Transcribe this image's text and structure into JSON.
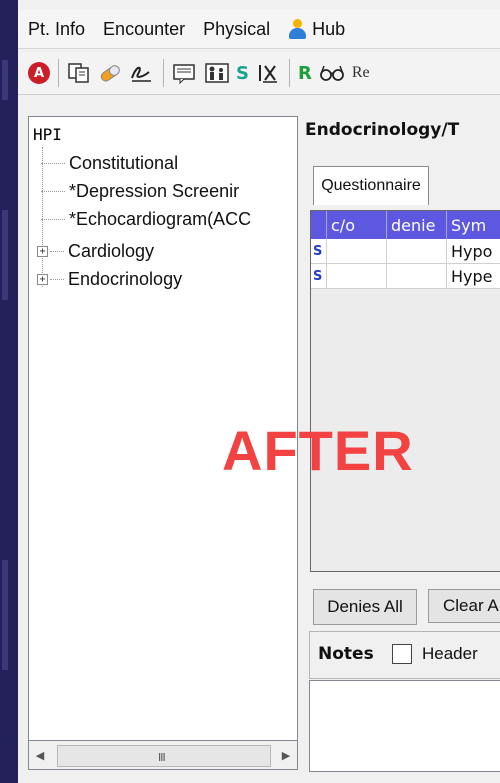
{
  "menu": {
    "items": [
      "Pt. Info",
      "Encounter",
      "Physical",
      "Hub"
    ]
  },
  "toolbar": {
    "stop_glyph": "A",
    "s_label": "S",
    "r_label": "R",
    "re_label": "Re"
  },
  "tree": {
    "root": "HPI",
    "items": [
      {
        "label": "Constitutional",
        "expandable": false
      },
      {
        "label": "*Depression Screenir",
        "expandable": false
      },
      {
        "label": "*Echocardiogram(ACC",
        "expandable": false
      },
      {
        "label": "Cardiology",
        "expandable": true
      },
      {
        "label": "Endocrinology",
        "expandable": true
      }
    ],
    "scroll_grip": "III"
  },
  "main": {
    "title": "Endocrinology/T",
    "tab": "Questionnaire",
    "columns": [
      "",
      "c/o",
      "denie",
      "Sym"
    ],
    "rows": [
      {
        "flag": "S",
        "co": "",
        "denies": "",
        "symptom": "Hypo"
      },
      {
        "flag": "S",
        "co": "",
        "denies": "",
        "symptom": "Hype"
      }
    ],
    "denies_all": "Denies All",
    "clear_all": "Clear A",
    "notes_label": "Notes",
    "notes_header": "Header"
  },
  "overlay": {
    "text": "AFTER"
  },
  "colors": {
    "accent": "#5e58e0",
    "overlay": "#f24242",
    "stop": "#cc1e2a",
    "background": "#1e1d4a"
  }
}
